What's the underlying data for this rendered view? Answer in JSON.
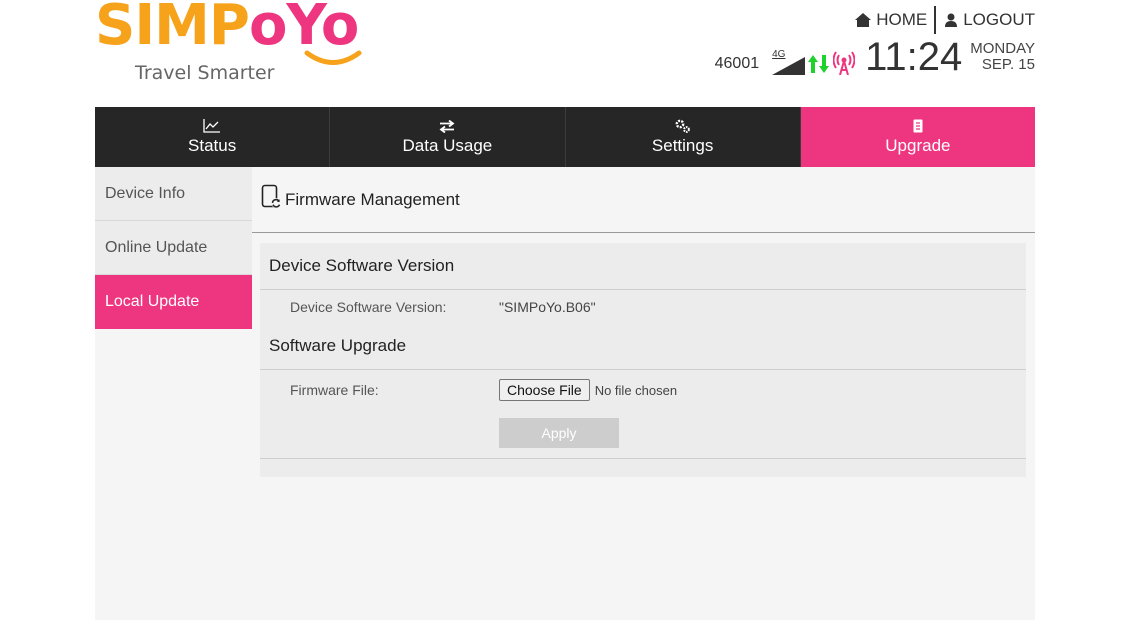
{
  "brand": {
    "name_part1": "SIMP",
    "name_part2": "oYo",
    "tagline": "Travel Smarter",
    "colors": {
      "orange": "#f7a21b",
      "pink": "#ee3580"
    }
  },
  "toplinks": {
    "home_label": "HOME",
    "home_icon": "home-icon",
    "logout_label": "LOGOUT",
    "logout_icon": "user-icon"
  },
  "status": {
    "carrier": "46001",
    "network_type": "4G",
    "time": "11:24",
    "day": "MONDAY",
    "date": "SEP. 15",
    "icons": [
      "signal-strength-icon",
      "data-transfer-arrows-icon",
      "wifi-antenna-icon"
    ]
  },
  "nav": {
    "tabs": [
      {
        "label": "Status",
        "icon": "line-chart-icon",
        "active": false
      },
      {
        "label": "Data Usage",
        "icon": "transfer-arrows-icon",
        "active": false
      },
      {
        "label": "Settings",
        "icon": "gears-icon",
        "active": false
      },
      {
        "label": "Upgrade",
        "icon": "upgrade-icon",
        "active": true
      }
    ],
    "active_color": "#ee3580"
  },
  "sidebar": {
    "items": [
      {
        "label": "Device Info",
        "active": false
      },
      {
        "label": "Online Update",
        "active": false
      },
      {
        "label": "Local Update",
        "active": true
      }
    ]
  },
  "content": {
    "page_title": "Firmware Management",
    "page_icon": "firmware-device-icon",
    "section1": {
      "title": "Device Software Version",
      "label": "Device Software Version:",
      "value": "\"SIMPoYo.B06\""
    },
    "section2": {
      "title": "Software Upgrade",
      "file_label": "Firmware File:",
      "choose_button": "Choose File",
      "no_file_text": "No file chosen",
      "apply_button": "Apply"
    }
  }
}
